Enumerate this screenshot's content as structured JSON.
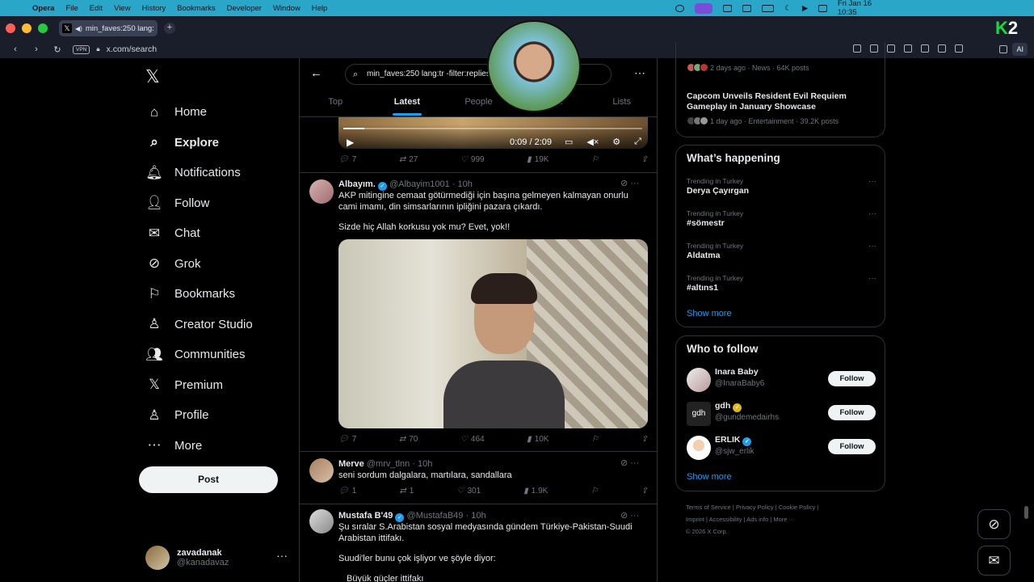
{
  "menubar": {
    "apple": "",
    "items": [
      "Opera",
      "File",
      "Edit",
      "View",
      "History",
      "Bookmarks",
      "Developer",
      "Window",
      "Help"
    ],
    "datetime": "Fri Jan 16  10:35"
  },
  "browser": {
    "tab_title": "min_faves:250 lang:",
    "tab_favicon": "𝕏",
    "url": "x.com/search",
    "vpn": "VPN",
    "ai": "AI",
    "k2_logo": "2"
  },
  "sidebar": {
    "logo": "𝕏",
    "items": [
      {
        "label": "Home",
        "icon": "⌂"
      },
      {
        "label": "Explore",
        "icon": "⌕"
      },
      {
        "label": "Notifications",
        "icon": "🔔︎"
      },
      {
        "label": "Follow",
        "icon": "👤︎"
      },
      {
        "label": "Chat",
        "icon": "✉"
      },
      {
        "label": "Grok",
        "icon": "⊘"
      },
      {
        "label": "Bookmarks",
        "icon": "⚐"
      },
      {
        "label": "Creator Studio",
        "icon": "♙"
      },
      {
        "label": "Communities",
        "icon": "👥︎"
      },
      {
        "label": "Premium",
        "icon": "𝕏"
      },
      {
        "label": "Profile",
        "icon": "♙"
      },
      {
        "label": "More",
        "icon": "⋯"
      }
    ],
    "post_button": "Post",
    "account": {
      "name": "zavadanak",
      "handle": "@kanadavaz",
      "more": "···"
    }
  },
  "search": {
    "query": "min_faves:250 lang:tr -filter:replies ... bahçe -",
    "tabs": [
      "Top",
      "Latest",
      "People",
      "Media",
      "Lists"
    ],
    "active_tab": "Latest"
  },
  "video1": {
    "time": "0:09 / 2:09",
    "progress": 0.07
  },
  "tweets": [
    {
      "stats": {
        "replies": "7",
        "reposts": "27",
        "likes": "999",
        "views": "19K"
      }
    },
    {
      "name": "Albayım.",
      "handle": "@Albayim1001",
      "time": "10h",
      "text1": "AKP mitingine cemaat götürmediği için başına gelmeyen kalmayan onurlu cami imamı, din simsarlarının ipliğini pazara çıkardı.",
      "text2": "Sizde hiç Allah korkusu yok mu? Evet, yok!!",
      "stats": {
        "replies": "7",
        "reposts": "70",
        "likes": "464",
        "views": "10K"
      }
    },
    {
      "name": "Merve",
      "handle": "@mrv_tlnn",
      "time": "10h",
      "text1": "seni sordum dalgalara, martılara, sandallara",
      "stats": {
        "replies": "1",
        "reposts": "1",
        "likes": "301",
        "views": "1.9K"
      }
    },
    {
      "name": "Mustafa B'49",
      "handle": "@MustafaB49",
      "time": "10h",
      "text1": "Şu sıralar S.Arabistan sosyal medyasında gündem Türkiye-Pakistan-Suudi Arabistan ittifakı.",
      "text2": "Suudi'ler bunu çok işliyor ve şöyle diyor:",
      "text3": "Büyük güçler ittifakı"
    }
  ],
  "right": {
    "news_top_meta": "2 days ago · News · 64K posts",
    "news_headline": "Capcom Unveils Resident Evil Requiem Gameplay in January Showcase",
    "news_meta": "1 day ago · Entertainment · 39.2K posts",
    "whats_happening": "What’s happening",
    "trends": [
      {
        "context": "Trending in Turkey",
        "name": "Derya Çayırgan"
      },
      {
        "context": "Trending in Turkey",
        "name": "#sömestr"
      },
      {
        "context": "Trending in Turkey",
        "name": "Aldatma"
      },
      {
        "context": "Trending in Turkey",
        "name": "#altıns1"
      }
    ],
    "show_more": "Show more",
    "who_to_follow": "Who to follow",
    "follow_label": "Follow",
    "suggestions": [
      {
        "name": "Inara Baby",
        "handle": "@InaraBaby6"
      },
      {
        "name": "gdh",
        "handle": "@gundemedairhs",
        "avatar_text": "gdh"
      },
      {
        "name": "ERLIK",
        "handle": "@sjw_erlik"
      }
    ],
    "footer": {
      "line1": "Terms of Service  |  Privacy Policy  |  Cookie Policy  |",
      "line2": "Imprint  |  Accessibility  |  Ads info  |  More ···",
      "line3": "© 2026 X Corp."
    }
  },
  "colors": {
    "accent": "#1d9bf0",
    "background": "#000000",
    "menubar": "#2aa6c9"
  }
}
